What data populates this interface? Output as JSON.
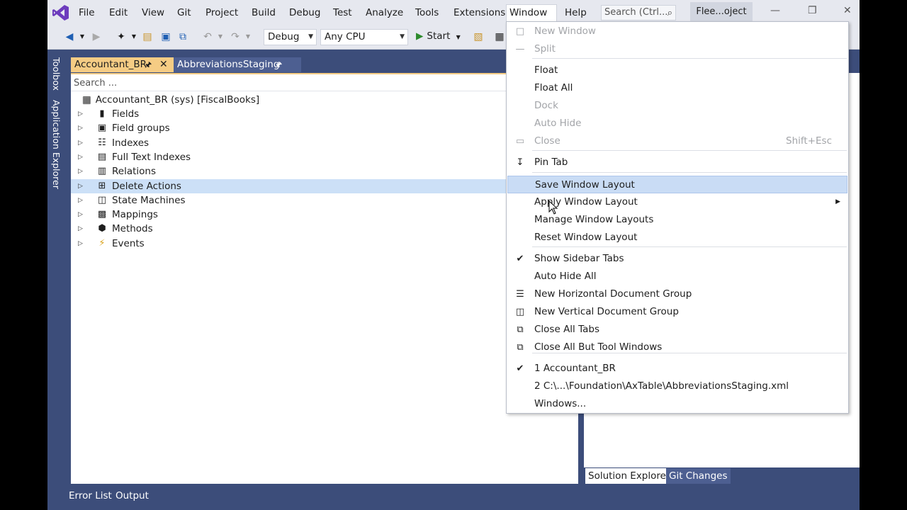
{
  "menubar": {
    "items": [
      "File",
      "Edit",
      "View",
      "Git",
      "Project",
      "Build",
      "Debug",
      "Test",
      "Analyze",
      "Tools",
      "Extensions",
      "Window",
      "Help"
    ],
    "search_placeholder": "Search (Ctrl...",
    "project_name": "Flee...oject"
  },
  "toolbar": {
    "config": "Debug",
    "platform": "Any CPU",
    "start_label": "Start"
  },
  "sidebar": {
    "toolbox": "Toolbox",
    "app_explorer": "Application Explorer"
  },
  "doc_tabs": [
    {
      "label": "Accountant_BR"
    },
    {
      "label": "AbbreviationsStaging"
    }
  ],
  "doc": {
    "search_placeholder": "Search ...",
    "root_label": "Accountant_BR (sys) [FiscalBooks]",
    "nodes": [
      {
        "label": "Fields",
        "icon": "field-icon"
      },
      {
        "label": "Field groups",
        "icon": "field-groups-icon"
      },
      {
        "label": "Indexes",
        "icon": "indexes-icon"
      },
      {
        "label": "Full Text Indexes",
        "icon": "full-text-index-icon"
      },
      {
        "label": "Relations",
        "icon": "relations-icon"
      },
      {
        "label": "Delete Actions",
        "icon": "delete-actions-icon"
      },
      {
        "label": "State Machines",
        "icon": "state-machine-icon"
      },
      {
        "label": "Mappings",
        "icon": "mappings-icon"
      },
      {
        "label": "Methods",
        "icon": "methods-icon"
      },
      {
        "label": "Events",
        "icon": "events-icon"
      }
    ]
  },
  "window_menu": {
    "items": [
      {
        "label": "New Window",
        "disabled": true
      },
      {
        "label": "Split",
        "disabled": true
      },
      {
        "label": "Float"
      },
      {
        "label": "Float All"
      },
      {
        "label": "Dock",
        "disabled": true
      },
      {
        "label": "Auto Hide",
        "disabled": true
      },
      {
        "label": "Close",
        "shortcut": "Shift+Esc",
        "disabled": true
      },
      {
        "label": "Pin Tab"
      },
      {
        "label": "Save Window Layout",
        "highlighted": true
      },
      {
        "label": "Apply Window Layout",
        "submenu": true
      },
      {
        "label": "Manage Window Layouts"
      },
      {
        "label": "Reset Window Layout"
      },
      {
        "label": "Show Sidebar Tabs",
        "checked": true
      },
      {
        "label": "Auto Hide All"
      },
      {
        "label": "New Horizontal Document Group"
      },
      {
        "label": "New Vertical Document Group"
      },
      {
        "label": "Close All Tabs"
      },
      {
        "label": "Close All But Tool Windows"
      },
      {
        "label": "1 Accountant_BR",
        "checked": true
      },
      {
        "label": "2 C:\\...\\Foundation\\AxTable\\AbbreviationsStaging.xml"
      },
      {
        "label": "Windows..."
      }
    ]
  },
  "right_tabs": [
    "Solution Explorer",
    "Git Changes"
  ],
  "bottom_tabs": [
    "Error List",
    "Output"
  ],
  "colors": {
    "accent": "#3c4d7a",
    "active_tab": "#f5cc84",
    "highlight": "#c9dcf5",
    "selection": "#cce0f7"
  }
}
